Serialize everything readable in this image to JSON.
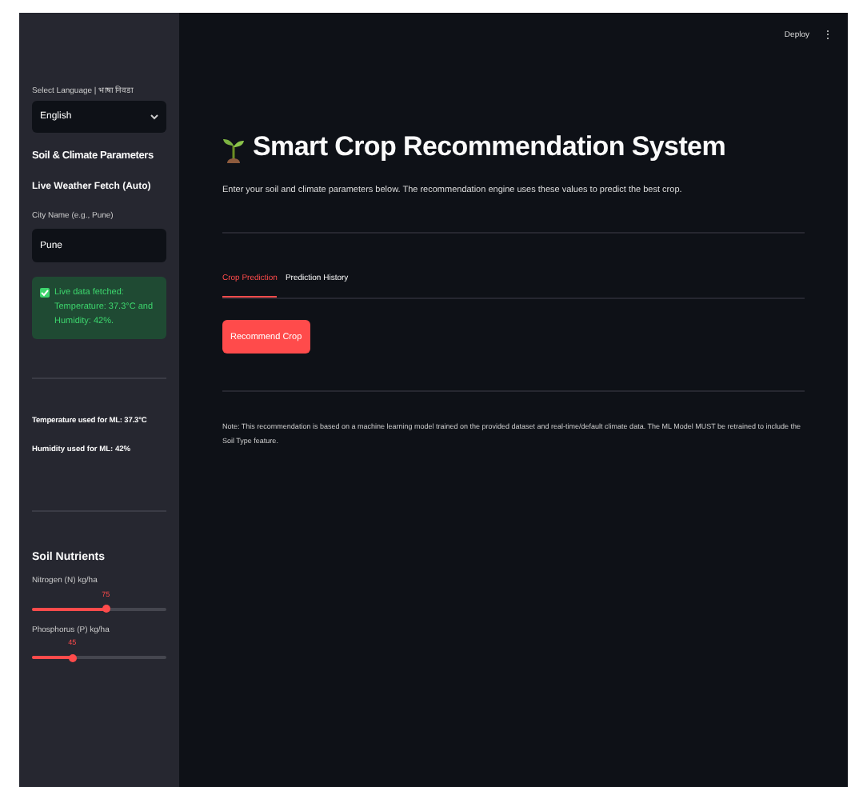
{
  "toolbar": {
    "deploy": "Deploy",
    "menu": "⋮"
  },
  "sidebar": {
    "language_label": "Select Language | भाषा निवडा",
    "language": "English",
    "section_title": "Soil & Climate Parameters",
    "weather_title": "Live Weather Fetch (Auto)",
    "city_label": "City Name (e.g., Pune)",
    "city": "Pune",
    "success": {
      "checked": true,
      "lines": [
        "Live data fetched:",
        "Temperature: 37.3°C and",
        "Humidity: 42%."
      ]
    },
    "temperature_used": "Temperature used for ML: 37.3°C",
    "humidity_used": "Humidity used for ML: 42%",
    "nutrients_title": "Soil Nutrients",
    "sliders": [
      {
        "label": "Nitrogen (N) kg/ha",
        "reading": "75",
        "level": 0.55
      },
      {
        "label": "Phosphorus (P) kg/ha",
        "reading": "45",
        "level": 0.3
      }
    ]
  },
  "main": {
    "title": "Smart Crop Recommendation System",
    "intro": "Enter your soil and climate parameters below. The recommendation engine uses these values to predict the best crop.",
    "tabs": [
      {
        "label": "Crop Prediction",
        "selected": true
      },
      {
        "label": "Prediction History",
        "selected": false
      }
    ],
    "button": "Recommend Crop",
    "note": "Note: This recommendation is based on a machine learning model trained on the provided dataset and real-time/default climate data. The ML Model MUST be retrained to include the Soil Type feature."
  }
}
